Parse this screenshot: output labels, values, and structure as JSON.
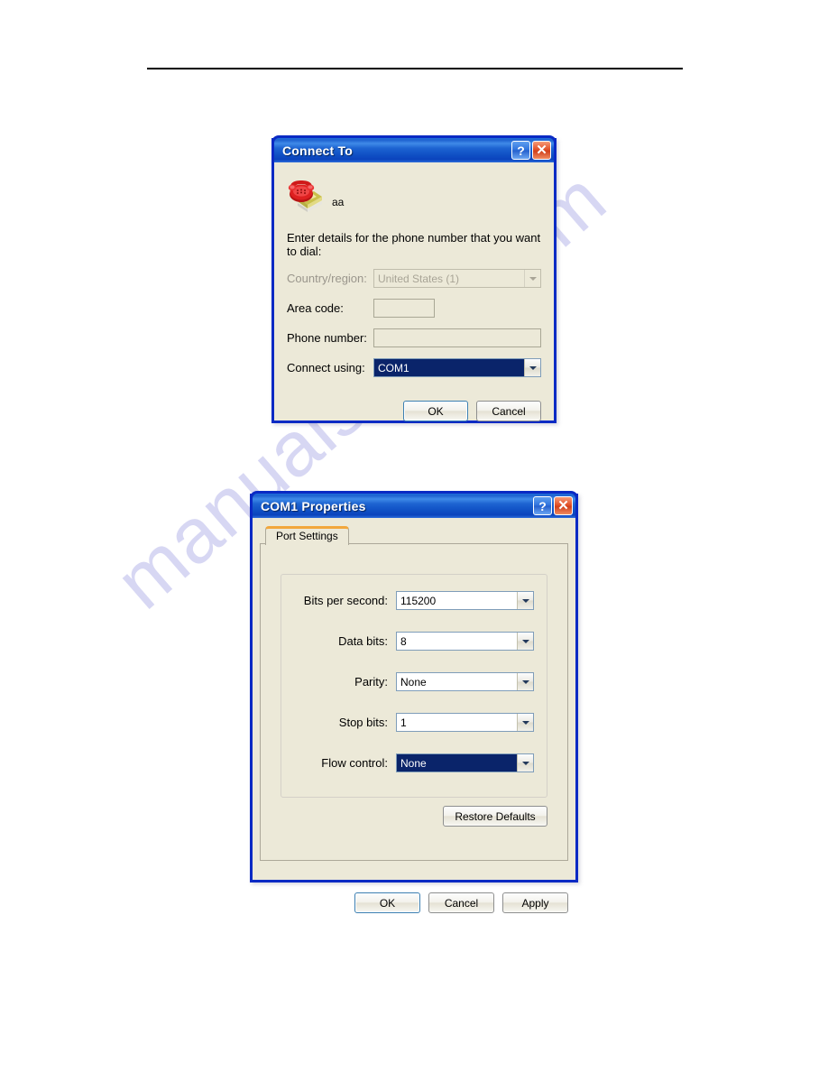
{
  "page": {
    "watermark_text": "manualshive.com",
    "background_color": "#ffffff",
    "rule_color": "#000000"
  },
  "dialogs": [
    {
      "id": "connect-to",
      "title": "Connect To",
      "titlebar_buttons": [
        {
          "name": "help-button",
          "glyph": "?"
        },
        {
          "name": "close-button",
          "glyph": "✕"
        }
      ],
      "connection_icon": "phone-icon",
      "connection_name": "aa",
      "instruction": "Enter details for the phone number that you want to dial:",
      "fields": [
        {
          "label": "Country/region:",
          "value": "United States (1)",
          "type": "combo",
          "state": "disabled"
        },
        {
          "label": "Area code:",
          "value": "",
          "type": "text",
          "state": "enabled"
        },
        {
          "label": "Phone number:",
          "value": "",
          "type": "text",
          "state": "enabled"
        },
        {
          "label": "Connect using:",
          "value": "COM1",
          "type": "combo",
          "state": "selected"
        }
      ],
      "buttons": [
        {
          "label": "OK",
          "default": true
        },
        {
          "label": "Cancel",
          "default": false
        }
      ]
    },
    {
      "id": "com1-properties",
      "title": "COM1 Properties",
      "titlebar_buttons": [
        {
          "name": "help-button",
          "glyph": "?"
        },
        {
          "name": "close-button",
          "glyph": "✕"
        }
      ],
      "tabs": [
        {
          "label": "Port Settings",
          "selected": true
        }
      ],
      "settings": [
        {
          "label": "Bits per second:",
          "value": "115200",
          "state": "enabled"
        },
        {
          "label": "Data bits:",
          "value": "8",
          "state": "enabled"
        },
        {
          "label": "Parity:",
          "value": "None",
          "state": "enabled"
        },
        {
          "label": "Stop bits:",
          "value": "1",
          "state": "enabled"
        },
        {
          "label": "Flow control:",
          "value": "None",
          "state": "selected"
        }
      ],
      "restore_label": "Restore Defaults",
      "buttons": [
        {
          "label": "OK",
          "default": true
        },
        {
          "label": "Cancel",
          "default": false
        },
        {
          "label": "Apply",
          "default": false
        }
      ]
    }
  ],
  "colors": {
    "titlebar_blue": "#1e62d0",
    "dialog_face": "#ece9d8",
    "selection_blue": "#0a246a",
    "tab_accent_orange": "#f2a73c",
    "watermark": "#c9c9ef"
  }
}
